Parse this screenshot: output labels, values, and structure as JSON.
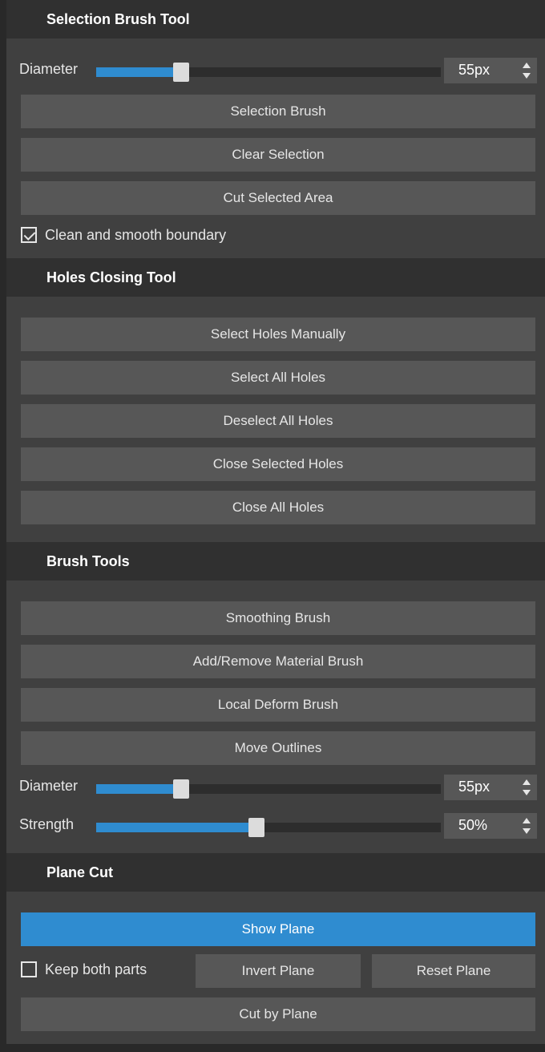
{
  "selection_brush": {
    "title": "Selection Brush Tool",
    "diameter_label": "Diameter",
    "diameter_value": "55px",
    "diameter_fraction": 0.18,
    "buttons": [
      "Selection Brush",
      "Clear Selection",
      "Cut Selected Area"
    ],
    "clean_smooth": {
      "label": "Clean and smooth boundary",
      "checked": true
    }
  },
  "holes_closing": {
    "title": "Holes Closing Tool",
    "buttons": [
      "Select Holes Manually",
      "Select All Holes",
      "Deselect All Holes",
      "Close Selected Holes",
      "Close All Holes"
    ]
  },
  "brush_tools": {
    "title": "Brush Tools",
    "buttons": [
      "Smoothing Brush",
      "Add/Remove Material Brush",
      "Local Deform Brush",
      "Move Outlines"
    ],
    "diameter_label": "Diameter",
    "diameter_value": "55px",
    "diameter_fraction": 0.18,
    "strength_label": "Strength",
    "strength_value": "50%",
    "strength_fraction": 0.5
  },
  "plane_cut": {
    "title": "Plane Cut",
    "show_plane": "Show Plane",
    "keep_both": {
      "label": "Keep both parts",
      "checked": false
    },
    "invert_plane": "Invert Plane",
    "reset_plane": "Reset Plane",
    "cut_by_plane": "Cut by Plane"
  },
  "colors": {
    "accent": "#2f8cd0",
    "button": "#575757",
    "panel": "#404040",
    "header": "#303030"
  }
}
